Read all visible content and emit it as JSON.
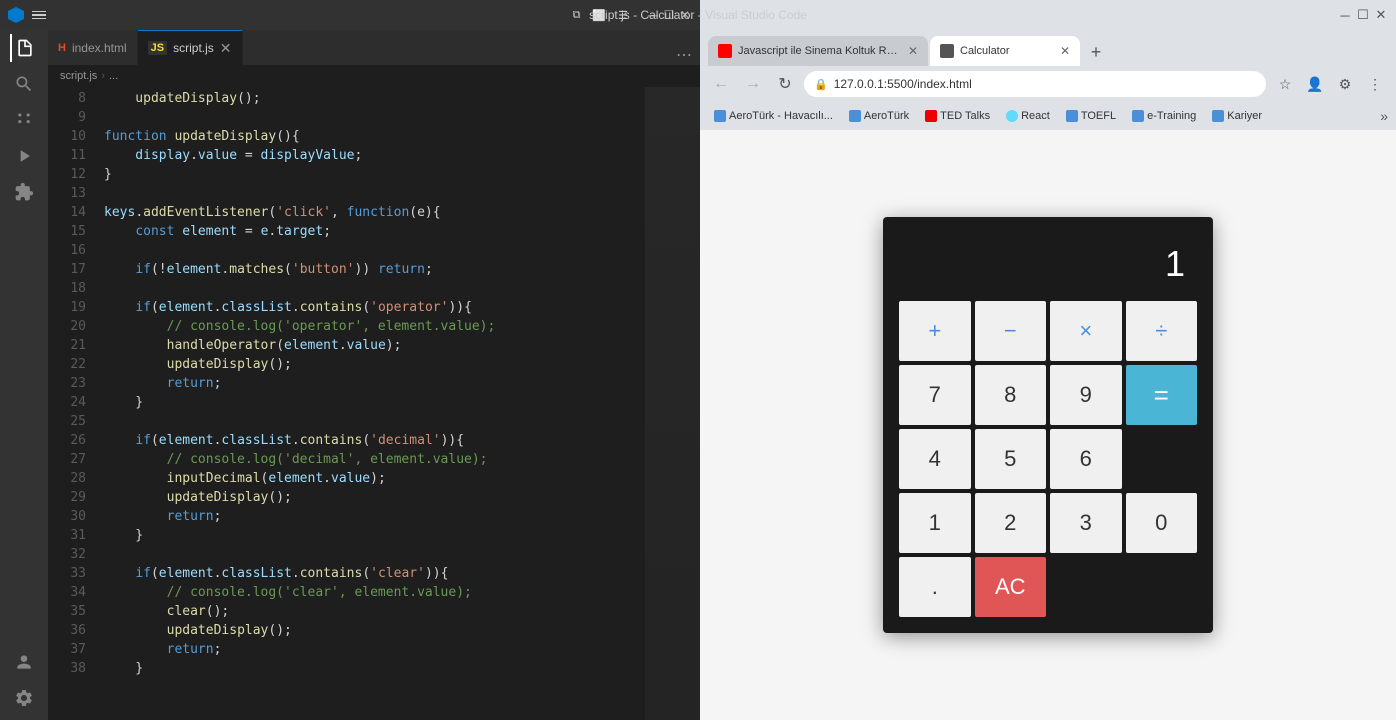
{
  "vscode": {
    "title": "script.js - Calculator - Visual Studio Code",
    "tabs": [
      {
        "label": "index.html",
        "type": "html",
        "active": false
      },
      {
        "label": "script.js",
        "type": "js",
        "active": true
      }
    ],
    "breadcrumb": [
      "script.js",
      "..."
    ],
    "lines": [
      {
        "num": 8,
        "active": false,
        "tokens": [
          {
            "t": "    updateDisplay();",
            "c": "fn"
          }
        ]
      },
      {
        "num": 9,
        "active": false,
        "tokens": []
      },
      {
        "num": 10,
        "active": false,
        "tokens": [
          {
            "t": "function ",
            "c": "kw"
          },
          {
            "t": "updateDisplay",
            "c": "fn"
          },
          {
            "t": "(){",
            "c": "punc"
          }
        ]
      },
      {
        "num": 11,
        "active": false,
        "tokens": [
          {
            "t": "    display",
            "c": "prop"
          },
          {
            "t": ".",
            "c": "punc"
          },
          {
            "t": "value",
            "c": "prop"
          },
          {
            "t": " = ",
            "c": "op"
          },
          {
            "t": "displayValue",
            "c": "prop"
          },
          {
            "t": ";",
            "c": "punc"
          }
        ]
      },
      {
        "num": 12,
        "active": false,
        "tokens": [
          {
            "t": "}",
            "c": "punc"
          }
        ]
      },
      {
        "num": 13,
        "active": false,
        "tokens": []
      },
      {
        "num": 14,
        "active": false,
        "tokens": [
          {
            "t": "keys",
            "c": "prop"
          },
          {
            "t": ".",
            "c": "punc"
          },
          {
            "t": "addEventListener",
            "c": "fn"
          },
          {
            "t": "(",
            "c": "punc"
          },
          {
            "t": "'click'",
            "c": "str"
          },
          {
            "t": ", ",
            "c": "punc"
          },
          {
            "t": "function",
            "c": "kw"
          },
          {
            "t": "(e){",
            "c": "punc"
          }
        ]
      },
      {
        "num": 15,
        "active": false,
        "tokens": [
          {
            "t": "    ",
            "c": ""
          },
          {
            "t": "const ",
            "c": "kw"
          },
          {
            "t": "element",
            "c": "prop"
          },
          {
            "t": " = ",
            "c": "op"
          },
          {
            "t": "e",
            "c": "prop"
          },
          {
            "t": ".",
            "c": "punc"
          },
          {
            "t": "target",
            "c": "prop"
          },
          {
            "t": ";",
            "c": "punc"
          }
        ]
      },
      {
        "num": 16,
        "active": false,
        "tokens": []
      },
      {
        "num": 17,
        "active": false,
        "tokens": [
          {
            "t": "    ",
            "c": ""
          },
          {
            "t": "if",
            "c": "kw"
          },
          {
            "t": "(!",
            "c": "punc"
          },
          {
            "t": "element",
            "c": "prop"
          },
          {
            "t": ".",
            "c": "punc"
          },
          {
            "t": "matches",
            "c": "fn"
          },
          {
            "t": "(",
            "c": "punc"
          },
          {
            "t": "'button'",
            "c": "str"
          },
          {
            "t": ")) ",
            "c": "punc"
          },
          {
            "t": "return",
            "c": "kw"
          },
          {
            "t": ";",
            "c": "punc"
          }
        ]
      },
      {
        "num": 18,
        "active": false,
        "tokens": []
      },
      {
        "num": 19,
        "active": false,
        "tokens": [
          {
            "t": "    ",
            "c": ""
          },
          {
            "t": "if",
            "c": "kw"
          },
          {
            "t": "(",
            "c": "punc"
          },
          {
            "t": "element",
            "c": "prop"
          },
          {
            "t": ".",
            "c": "punc"
          },
          {
            "t": "classList",
            "c": "prop"
          },
          {
            "t": ".",
            "c": "punc"
          },
          {
            "t": "contains",
            "c": "fn"
          },
          {
            "t": "(",
            "c": "punc"
          },
          {
            "t": "'operator'",
            "c": "str"
          },
          {
            "t": ")){",
            "c": "punc"
          }
        ]
      },
      {
        "num": 20,
        "active": false,
        "tokens": [
          {
            "t": "        ",
            "c": ""
          },
          {
            "t": "// console.log('operator', element.value);",
            "c": "cmt"
          }
        ]
      },
      {
        "num": 21,
        "active": false,
        "tokens": [
          {
            "t": "        ",
            "c": ""
          },
          {
            "t": "handleOperator",
            "c": "fn"
          },
          {
            "t": "(",
            "c": "punc"
          },
          {
            "t": "element",
            "c": "prop"
          },
          {
            "t": ".",
            "c": "punc"
          },
          {
            "t": "value",
            "c": "prop"
          },
          {
            "t": ");",
            "c": "punc"
          }
        ]
      },
      {
        "num": 22,
        "active": false,
        "tokens": [
          {
            "t": "        ",
            "c": ""
          },
          {
            "t": "updateDisplay",
            "c": "fn"
          },
          {
            "t": "();",
            "c": "punc"
          }
        ]
      },
      {
        "num": 23,
        "active": false,
        "tokens": [
          {
            "t": "        ",
            "c": ""
          },
          {
            "t": "return",
            "c": "kw"
          },
          {
            "t": ";",
            "c": "punc"
          }
        ]
      },
      {
        "num": 24,
        "active": false,
        "tokens": [
          {
            "t": "    }",
            "c": "punc"
          }
        ]
      },
      {
        "num": 25,
        "active": false,
        "tokens": []
      },
      {
        "num": 26,
        "active": false,
        "tokens": [
          {
            "t": "    ",
            "c": ""
          },
          {
            "t": "if",
            "c": "kw"
          },
          {
            "t": "(",
            "c": "punc"
          },
          {
            "t": "element",
            "c": "prop"
          },
          {
            "t": ".",
            "c": "punc"
          },
          {
            "t": "classList",
            "c": "prop"
          },
          {
            "t": ".",
            "c": "punc"
          },
          {
            "t": "contains",
            "c": "fn"
          },
          {
            "t": "(",
            "c": "punc"
          },
          {
            "t": "'decimal'",
            "c": "str"
          },
          {
            "t": ")){",
            "c": "punc"
          }
        ]
      },
      {
        "num": 27,
        "active": false,
        "tokens": [
          {
            "t": "        ",
            "c": ""
          },
          {
            "t": "// console.log('decimal', element.value);",
            "c": "cmt"
          }
        ]
      },
      {
        "num": 28,
        "active": false,
        "tokens": [
          {
            "t": "        ",
            "c": ""
          },
          {
            "t": "inputDecimal",
            "c": "fn"
          },
          {
            "t": "(",
            "c": "punc"
          },
          {
            "t": "element",
            "c": "prop"
          },
          {
            "t": ".",
            "c": "punc"
          },
          {
            "t": "value",
            "c": "prop"
          },
          {
            "t": ");",
            "c": "punc"
          }
        ]
      },
      {
        "num": 29,
        "active": false,
        "tokens": [
          {
            "t": "        ",
            "c": ""
          },
          {
            "t": "updateDisplay",
            "c": "fn"
          },
          {
            "t": "();",
            "c": "punc"
          }
        ]
      },
      {
        "num": 30,
        "active": false,
        "tokens": [
          {
            "t": "        ",
            "c": ""
          },
          {
            "t": "return",
            "c": "kw"
          },
          {
            "t": ";",
            "c": "punc"
          }
        ]
      },
      {
        "num": 31,
        "active": false,
        "tokens": [
          {
            "t": "    }",
            "c": "punc"
          }
        ]
      },
      {
        "num": 32,
        "active": false,
        "tokens": []
      },
      {
        "num": 33,
        "active": false,
        "tokens": [
          {
            "t": "    ",
            "c": ""
          },
          {
            "t": "if",
            "c": "kw"
          },
          {
            "t": "(",
            "c": "punc"
          },
          {
            "t": "element",
            "c": "prop"
          },
          {
            "t": ".",
            "c": "punc"
          },
          {
            "t": "classList",
            "c": "prop"
          },
          {
            "t": ".",
            "c": "punc"
          },
          {
            "t": "contains",
            "c": "fn"
          },
          {
            "t": "(",
            "c": "punc"
          },
          {
            "t": "'clear'",
            "c": "str"
          },
          {
            "t": ")){",
            "c": "punc"
          }
        ]
      },
      {
        "num": 34,
        "active": false,
        "tokens": [
          {
            "t": "        ",
            "c": ""
          },
          {
            "t": "// console.log('clear', element.value);",
            "c": "cmt"
          }
        ]
      },
      {
        "num": 35,
        "active": false,
        "tokens": [
          {
            "t": "        ",
            "c": ""
          },
          {
            "t": "clear",
            "c": "fn"
          },
          {
            "t": "();",
            "c": "punc"
          }
        ]
      },
      {
        "num": 36,
        "active": false,
        "tokens": [
          {
            "t": "        ",
            "c": ""
          },
          {
            "t": "updateDisplay",
            "c": "fn"
          },
          {
            "t": "();",
            "c": "punc"
          }
        ]
      },
      {
        "num": 37,
        "active": false,
        "tokens": [
          {
            "t": "        ",
            "c": ""
          },
          {
            "t": "return",
            "c": "kw"
          },
          {
            "t": ";",
            "c": "punc"
          }
        ]
      },
      {
        "num": 38,
        "active": false,
        "tokens": [
          {
            "t": "    }",
            "c": "punc"
          }
        ]
      }
    ]
  },
  "browser": {
    "tabs": [
      {
        "label": "Javascript ile Sinema Koltuk Rez...",
        "favicon_color": "#ff0000",
        "active": false
      },
      {
        "label": "Calculator",
        "favicon_color": "#888888",
        "active": true
      }
    ],
    "address": "127.0.0.1:5500/index.html",
    "bookmarks": [
      {
        "label": "AeroTürk - Havacılı...",
        "color": "#4a90d9"
      },
      {
        "label": "AeroTürk",
        "color": "#4a90d9"
      },
      {
        "label": "TED Talks",
        "color": "#e00"
      },
      {
        "label": "React",
        "color": "#61dafb"
      },
      {
        "label": "TOEFL",
        "color": "#4a90d9"
      },
      {
        "label": "e-Training",
        "color": "#4a90d9"
      },
      {
        "label": "Kariyer",
        "color": "#4a90d9"
      }
    ]
  },
  "calculator": {
    "display": "1",
    "buttons": [
      [
        {
          "label": "+",
          "type": "operator"
        },
        {
          "label": "-",
          "type": "operator"
        },
        {
          "label": "×",
          "type": "operator"
        },
        {
          "label": "÷",
          "type": "operator"
        }
      ],
      [
        {
          "label": "7",
          "type": "num"
        },
        {
          "label": "8",
          "type": "num"
        },
        {
          "label": "9",
          "type": "num"
        },
        {
          "label": "=",
          "type": "equals"
        }
      ],
      [
        {
          "label": "4",
          "type": "num"
        },
        {
          "label": "5",
          "type": "num"
        },
        {
          "label": "6",
          "type": "num"
        }
      ],
      [
        {
          "label": "1",
          "type": "num"
        },
        {
          "label": "2",
          "type": "num"
        },
        {
          "label": "3",
          "type": "num"
        }
      ],
      [
        {
          "label": "0",
          "type": "num"
        },
        {
          "label": ".",
          "type": "num"
        },
        {
          "label": "AC",
          "type": "clear"
        }
      ]
    ]
  }
}
